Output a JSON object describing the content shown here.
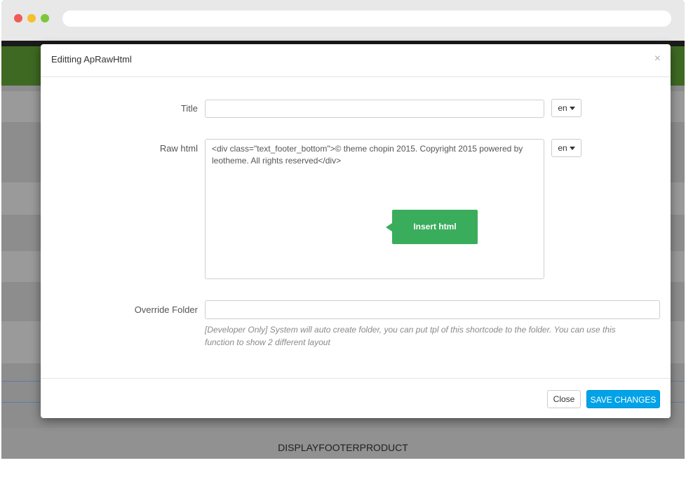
{
  "modal": {
    "title": "Editting ApRawHtml",
    "close_glyph": "×",
    "fields": {
      "title_label": "Title",
      "title_value": "",
      "title_lang": "en",
      "raw_label": "Raw html",
      "raw_value": "<div class=\"text_footer_bottom\">© theme chopin 2015. Copyright 2015 powered by leotheme. All rights reserved</div>",
      "raw_lang": "en",
      "override_label": "Override Folder",
      "override_value": "",
      "override_help": "[Developer Only] System will auto create folder, you can put tpl of this shortcode to the folder. You can use this function to show 2 different layout"
    },
    "tooltip": "Insert  html",
    "footer": {
      "close_label": "Close",
      "save_label": "SAVE CHANGES"
    }
  },
  "background": {
    "footer_label": "DISPLAYFOOTERPRODUCT"
  },
  "colors": {
    "accent_save": "#00a3e8",
    "tooltip_green": "#3aad5c",
    "header_green": "#3e6922"
  }
}
